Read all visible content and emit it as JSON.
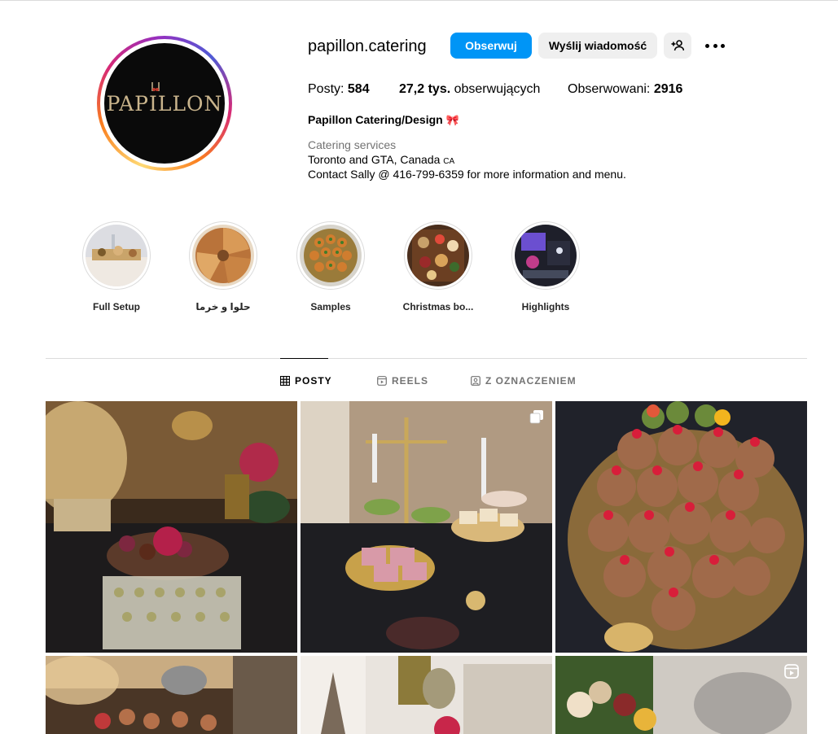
{
  "profile": {
    "username": "papillon.catering",
    "avatar_logo_text": "PAPILLON",
    "buttons": {
      "follow": "Obserwuj",
      "message": "Wyślij wiadomość"
    },
    "stats": {
      "posts_label": "Posty: ",
      "posts_value": "584",
      "followers_value": "27,2 tys.",
      "followers_label": " obserwujących",
      "following_label": "Obserwowani: ",
      "following_value": "2916"
    },
    "full_name": "Papillon Catering/Design",
    "category": "Catering services",
    "bio_line1": "Toronto and GTA, Canada",
    "bio_line1_flag": "CA",
    "bio_line2": "Contact Sally @ 416-799-6359 for more information and menu."
  },
  "highlights": [
    {
      "label": "Full Setup"
    },
    {
      "label": "حلوا و خرما"
    },
    {
      "label": "Samples"
    },
    {
      "label": "Christmas bo..."
    },
    {
      "label": "Highlights"
    }
  ],
  "tabs": {
    "posts": "POSTY",
    "reels": "REELS",
    "tagged": "Z OZNACZENIEM"
  },
  "icons": {
    "more": "more-horizontal-icon",
    "suggest": "add-person-icon",
    "posts_tab": "grid-icon",
    "reels_tab": "reels-icon",
    "tagged_tab": "tagged-icon",
    "carousel": "carousel-icon",
    "reel": "reel-icon"
  },
  "colors": {
    "follow_button": "#0095f6",
    "secondary_button": "#efefef",
    "muted_text": "#737373"
  }
}
